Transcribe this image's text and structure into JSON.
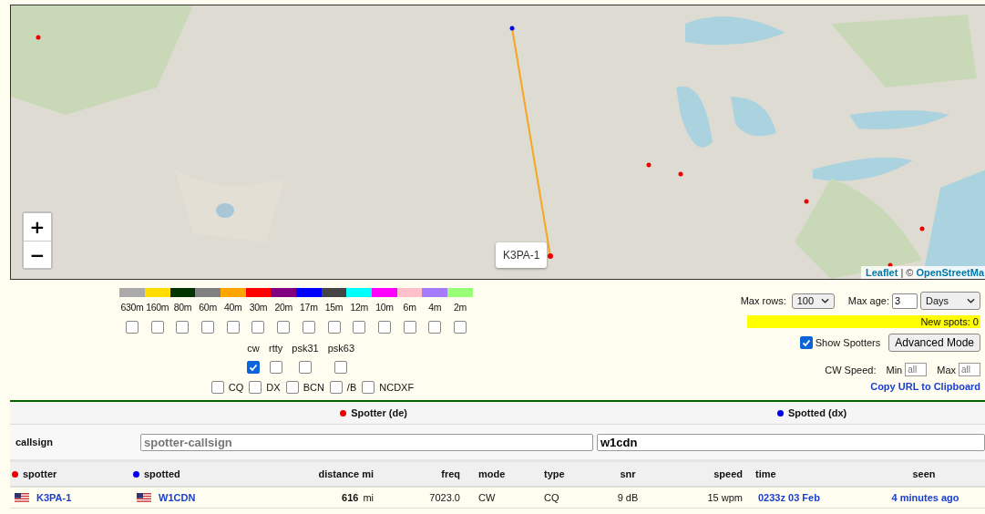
{
  "map": {
    "zoom_in": "+",
    "zoom_out": "−",
    "tooltip": "K3PA-1",
    "attribution": {
      "link": "Leaflet",
      "separator": "| ©",
      "source": "OpenStreetMa"
    }
  },
  "bands": [
    {
      "label": "630m",
      "color": "#aaaaaa",
      "checked": false
    },
    {
      "label": "160m",
      "color": "#ffdd00",
      "checked": false
    },
    {
      "label": "80m",
      "color": "#003300",
      "checked": false
    },
    {
      "label": "60m",
      "color": "#808080",
      "checked": false
    },
    {
      "label": "40m",
      "color": "#ffa500",
      "checked": false
    },
    {
      "label": "30m",
      "color": "#ff0000",
      "checked": false
    },
    {
      "label": "20m",
      "color": "#800080",
      "checked": false
    },
    {
      "label": "17m",
      "color": "#0000ff",
      "checked": false
    },
    {
      "label": "15m",
      "color": "#444444",
      "checked": false
    },
    {
      "label": "12m",
      "color": "#00ffff",
      "checked": false
    },
    {
      "label": "10m",
      "color": "#ff00ff",
      "checked": false
    },
    {
      "label": "6m",
      "color": "#ffc0cb",
      "checked": false
    },
    {
      "label": "4m",
      "color": "#a67cff",
      "checked": false
    },
    {
      "label": "2m",
      "color": "#99ff77",
      "checked": false
    }
  ],
  "modes": [
    {
      "label": "cw",
      "checked": true
    },
    {
      "label": "rtty",
      "checked": false
    },
    {
      "label": "psk31",
      "checked": false
    },
    {
      "label": "psk63",
      "checked": false
    }
  ],
  "types": [
    {
      "label": "CQ",
      "checked": false
    },
    {
      "label": "DX",
      "checked": false
    },
    {
      "label": "BCN",
      "checked": false
    },
    {
      "label": "/B",
      "checked": false
    },
    {
      "label": "NCDXF",
      "checked": false
    }
  ],
  "options": {
    "max_rows_label": "Max rows:",
    "max_rows": "100",
    "max_age_label": "Max age:",
    "max_age": "3",
    "age_unit": "Days",
    "new_spots": "New spots: 0",
    "show_spotters": {
      "label": "Show Spotters",
      "checked": true
    },
    "advanced_button": "Advanced Mode",
    "cw_speed_label": "CW Speed:",
    "min_label": "Min",
    "min_placeholder": "all",
    "max_label": "Max",
    "max_placeholder": "all",
    "copy_link": "Copy URL to Clipboard"
  },
  "filter": {
    "spotter_heading": "Spotter (de)",
    "spotted_heading": "Spotted (dx)",
    "label": "callsign",
    "spotter_placeholder": "spotter-callsign",
    "spotted_value": "w1cdn"
  },
  "table": {
    "columns": [
      "spotter",
      "spotted",
      "distance mi",
      "freq",
      "mode",
      "type",
      "snr",
      "speed",
      "time",
      "seen"
    ],
    "rows": [
      {
        "spotter": "K3PA-1",
        "spotted": "W1CDN",
        "distance": "616",
        "distance_unit": "mi",
        "freq": "7023.0",
        "mode": "CW",
        "type": "CQ",
        "snr": "9 dB",
        "speed": "15 wpm",
        "time": "0233z 03 Feb",
        "seen": "4 minutes ago"
      }
    ]
  }
}
